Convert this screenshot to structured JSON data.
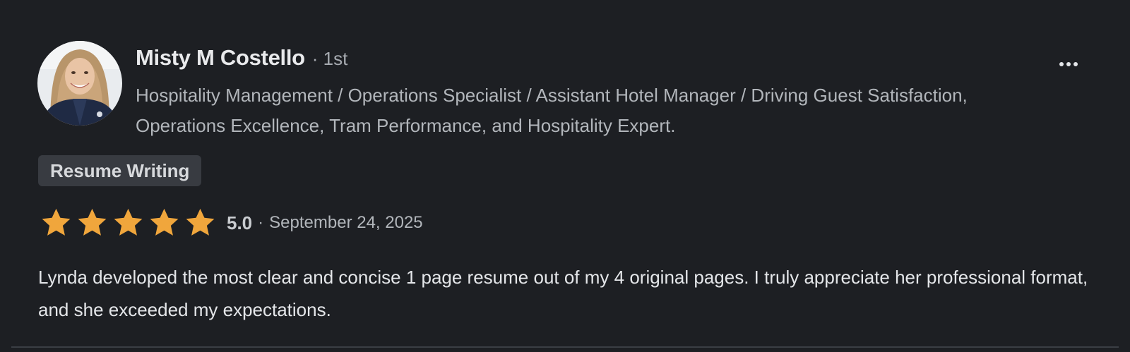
{
  "review": {
    "reviewer": {
      "name": "Misty M Costello",
      "connection": "· 1st",
      "headline": "Hospitality Management / Operations Specialist / Assistant Hotel Manager / Driving Guest Satisfaction, Operations Excellence, Tram Performance, and Hospitality Expert."
    },
    "service_tag": "Resume Writing",
    "rating": {
      "stars": 5,
      "max_stars": 5,
      "value": "5.0",
      "separator": "·",
      "date": "September 24, 2025",
      "star_color": "#f0a63c"
    },
    "text": "Lynda developed the most clear and concise 1 page resume out of my 4 original pages. I truly appreciate her professional format, and she exceeded my expectations.",
    "more_menu_icon": "ellipsis-icon"
  },
  "colors": {
    "background": "#1d1f23",
    "name": "#e9eaec",
    "secondary_text": "#b2b6bb",
    "tag_background": "#383b41",
    "body_text": "#e4e6e9"
  }
}
